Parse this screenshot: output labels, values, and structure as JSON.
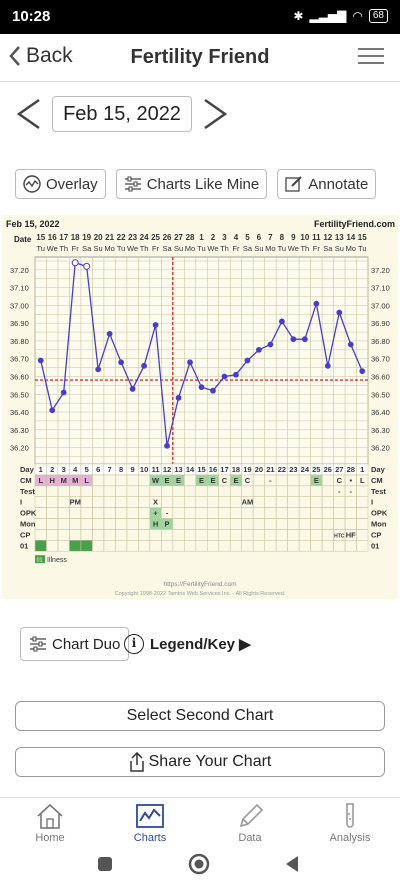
{
  "status": {
    "time": "10:28",
    "battery": "68"
  },
  "header": {
    "back_label": "Back",
    "title": "Fertility Friend"
  },
  "date_nav": {
    "date": "Feb 15, 2022"
  },
  "toolbar": {
    "overlay": "Overlay",
    "charts_like_mine": "Charts Like Mine",
    "annotate": "Annotate"
  },
  "chart_data": {
    "type": "line",
    "header_date": "Feb 15, 2022",
    "site": "FertilityFriend.com",
    "date_label": "Date",
    "dates": [
      "15",
      "16",
      "17",
      "18",
      "19",
      "20",
      "21",
      "22",
      "23",
      "24",
      "25",
      "26",
      "27",
      "28",
      "1",
      "2",
      "3",
      "4",
      "5",
      "6",
      "7",
      "8",
      "9",
      "10",
      "11",
      "12",
      "13",
      "14",
      "15"
    ],
    "weekdays": [
      "Tu",
      "We",
      "Th",
      "Fr",
      "Sa",
      "Su",
      "Mo",
      "Tu",
      "We",
      "Th",
      "Fr",
      "Sa",
      "Su",
      "Mo",
      "Tu",
      "We",
      "Th",
      "Fr",
      "Sa",
      "Su",
      "Mo",
      "Tu",
      "We",
      "Th",
      "Fr",
      "Sa",
      "Su",
      "Mo",
      "Tu"
    ],
    "y_ticks": [
      "37.20",
      "37.10",
      "37.00",
      "36.90",
      "36.80",
      "36.70",
      "36.60",
      "36.50",
      "36.40",
      "36.30",
      "36.20"
    ],
    "ylim": [
      36.13,
      37.25
    ],
    "temps": [
      36.69,
      36.41,
      36.51,
      37.24,
      37.22,
      36.64,
      36.84,
      36.68,
      36.53,
      36.66,
      36.89,
      36.21,
      36.48,
      36.68,
      36.54,
      36.52,
      36.6,
      36.61,
      36.69,
      36.75,
      36.78,
      36.91,
      36.81,
      36.81,
      37.01,
      36.66,
      36.96,
      36.78,
      36.63
    ],
    "open_circles": [
      3,
      4
    ],
    "coverline": 36.58,
    "ovulation_day_index": 12,
    "rows": {
      "day": {
        "label": "Day",
        "values": [
          "1",
          "2",
          "3",
          "4",
          "5",
          "6",
          "7",
          "8",
          "9",
          "10",
          "11",
          "12",
          "13",
          "14",
          "15",
          "16",
          "17",
          "18",
          "19",
          "20",
          "21",
          "22",
          "23",
          "24",
          "25",
          "26",
          "27",
          "28",
          "1"
        ]
      },
      "cm": {
        "label": "CM",
        "values": [
          "L",
          "H",
          "M",
          "M",
          "L",
          "",
          "",
          "",
          "",
          "",
          "W",
          "E",
          "E",
          "",
          "E",
          "E",
          "C",
          "E",
          "C",
          "",
          "-",
          "",
          "",
          "",
          "E",
          "",
          "C",
          "•",
          "L"
        ]
      },
      "test": {
        "label": "Test",
        "values": [
          "",
          "",
          "",
          "",
          "",
          "",
          "",
          "",
          "",
          "",
          "",
          "",
          "",
          "",
          "",
          "",
          "",
          "",
          "",
          "",
          "",
          "",
          "",
          "",
          "",
          "",
          "-",
          "-",
          ""
        ]
      },
      "i": {
        "label": "I",
        "values": [
          "",
          "",
          "",
          "PM",
          "",
          "",
          "",
          "",
          "",
          "",
          "X",
          "",
          "",
          "",
          "",
          "",
          "",
          "",
          "AM",
          "",
          "",
          "",
          "",
          "",
          "",
          "",
          "",
          "",
          ""
        ]
      },
      "opk": {
        "label": "OPK",
        "values": [
          "",
          "",
          "",
          "",
          "",
          "",
          "",
          "",
          "",
          "",
          "+",
          "-",
          "",
          "",
          "",
          "",
          "",
          "",
          "",
          "",
          "",
          "",
          "",
          "",
          "",
          "",
          "",
          "",
          ""
        ]
      },
      "mon": {
        "label": "Mon",
        "values": [
          "",
          "",
          "",
          "",
          "",
          "",
          "",
          "",
          "",
          "",
          "H",
          "P",
          "",
          "",
          "",
          "",
          "",
          "",
          "",
          "",
          "",
          "",
          "",
          "",
          "",
          "",
          "",
          "",
          ""
        ]
      },
      "cp": {
        "label": "CP",
        "values": [
          "",
          "",
          "",
          "",
          "",
          "",
          "",
          "",
          "",
          "",
          "",
          "",
          "",
          "",
          "",
          "",
          "",
          "",
          "",
          "",
          "",
          "",
          "",
          "",
          "",
          "",
          "HTC",
          "HF",
          ""
        ]
      },
      "code": {
        "label": "01",
        "values": []
      }
    },
    "illness_label": "Illness",
    "illness_code": "01",
    "footer_url": "https://FertilityFriend.com",
    "copyright": "Copyright 1998-2022 Tamtris Web Services Inc. - All Rights Reserved.",
    "colors": {
      "line": "#4a3ec8",
      "grid": "#c8c3a0",
      "coverline": "#e03030",
      "menses": "#e8b0d8",
      "fertile": "#9fd49f"
    }
  },
  "bottom_actions": {
    "chart_duo": "Chart Duo",
    "legend": "Legend/Key ▶",
    "select_second": "Select Second Chart",
    "share": "Share Your Chart"
  },
  "tabs": [
    {
      "label": "Home",
      "icon": "home-icon"
    },
    {
      "label": "Charts",
      "icon": "chart-icon"
    },
    {
      "label": "Data",
      "icon": "pencil-icon"
    },
    {
      "label": "Analysis",
      "icon": "test-tube-icon"
    }
  ]
}
